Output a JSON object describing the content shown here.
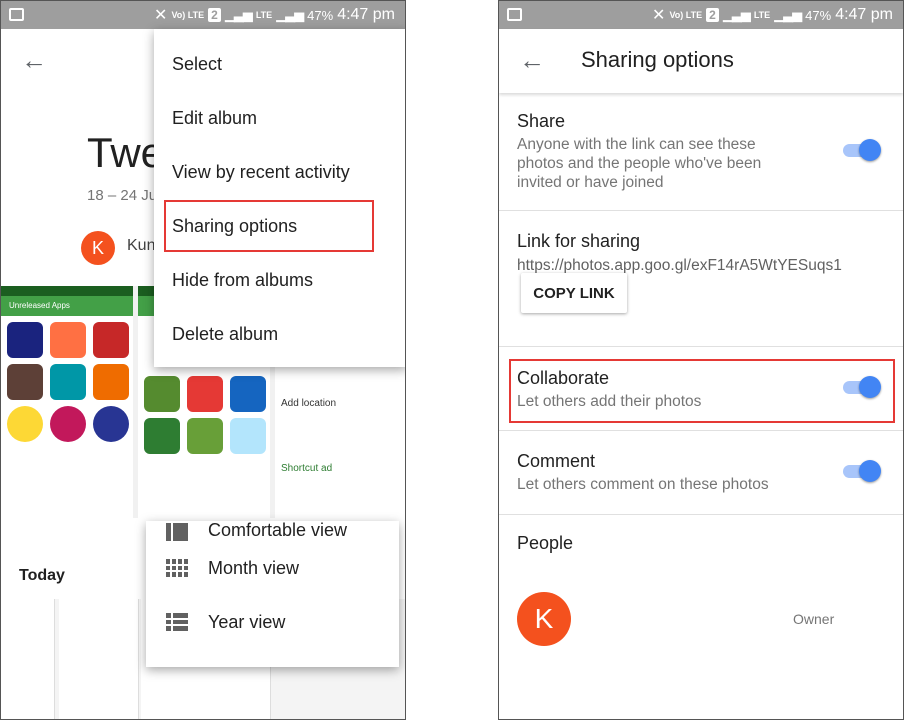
{
  "status_bar": {
    "volte": "Vo) LTE",
    "sim": "2",
    "lte": "LTE",
    "battery": "47%",
    "time": "4:47 pm"
  },
  "left": {
    "album_title": "Twe",
    "album_dates": "18 – 24 Ju",
    "owner_initial": "K",
    "owner_name": "Kun",
    "overflow_menu": [
      "Select",
      "Edit album",
      "View by recent activity",
      "Sharing options",
      "Hide from albums",
      "Delete album"
    ],
    "highlighted_item": "Sharing options",
    "thumb_app_bar": "Unreleased Apps",
    "thumb_text": "Add location",
    "thumb_text2": "Shortcut ad",
    "today_label": "Today",
    "view_menu": [
      "Comfortable view",
      "Month view",
      "Year view"
    ]
  },
  "right": {
    "title": "Sharing options",
    "share": {
      "title": "Share",
      "desc_line1": "Anyone with the link can see these",
      "desc_line2": "photos and the people who've been",
      "desc_line3": "invited or have joined",
      "enabled": true
    },
    "link": {
      "title": "Link for sharing",
      "url": "https://photos.app.goo.gl/exF14rA5WtYESuqs1",
      "copy_label": "COPY LINK"
    },
    "collaborate": {
      "title": "Collaborate",
      "desc": "Let others add their photos",
      "enabled": true
    },
    "comment": {
      "title": "Comment",
      "desc": "Let others comment on these photos",
      "enabled": true
    },
    "people": {
      "title": "People",
      "owner_initial": "K",
      "owner_role": "Owner"
    }
  },
  "colors": {
    "accent": "#4285f4",
    "highlight": "#e53935",
    "avatar": "#f4511e",
    "status_bar": "#9e9e9e"
  }
}
